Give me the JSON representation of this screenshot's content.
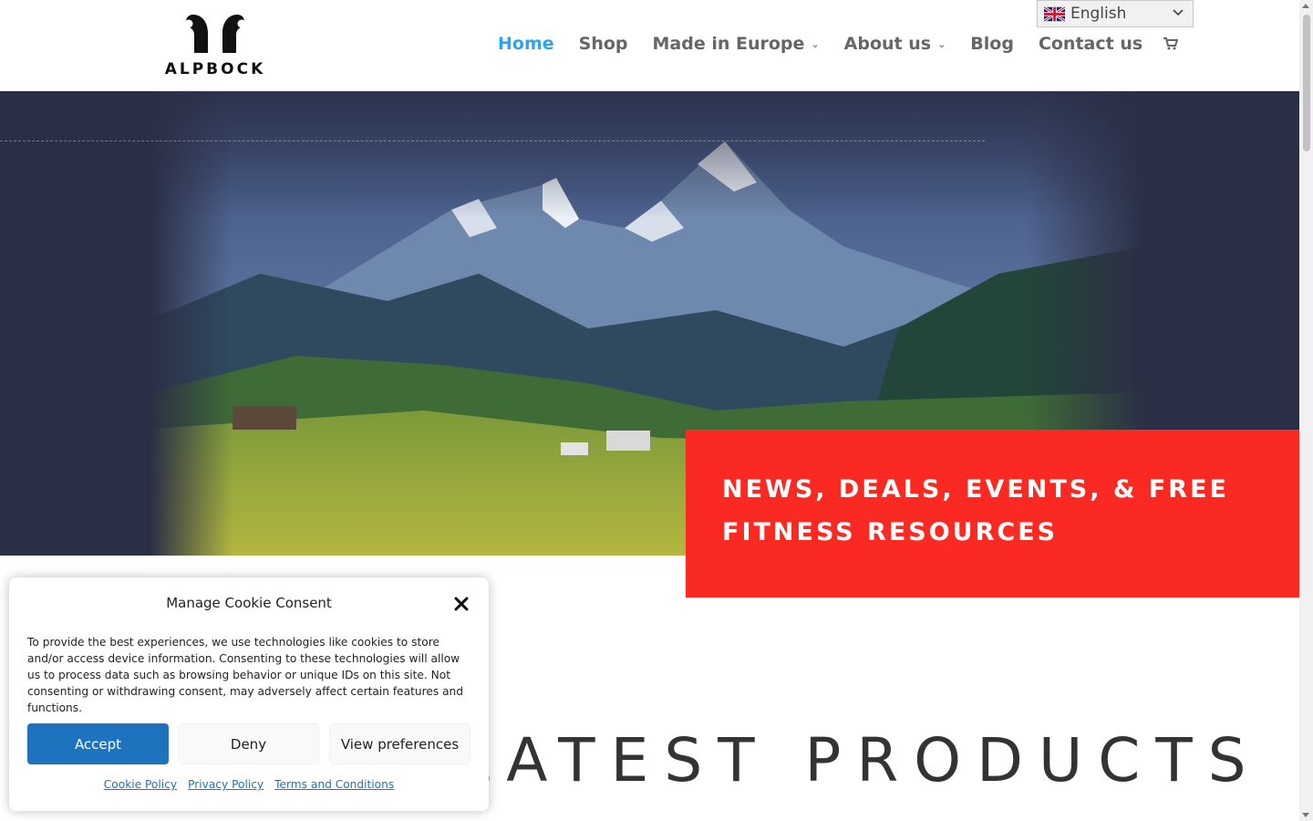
{
  "brand": {
    "name": "ALPBOCK"
  },
  "nav": {
    "items": [
      {
        "label": "Home",
        "active": true,
        "dropdown": false
      },
      {
        "label": "Shop",
        "active": false,
        "dropdown": false
      },
      {
        "label": "Made in Europe",
        "active": false,
        "dropdown": true
      },
      {
        "label": "About us",
        "active": false,
        "dropdown": true
      },
      {
        "label": "Blog",
        "active": false,
        "dropdown": false
      },
      {
        "label": "Contact us",
        "active": false,
        "dropdown": false
      }
    ],
    "cart_icon": "shopping-cart-icon"
  },
  "language": {
    "selected": "English",
    "flag_icon": "uk-flag-icon"
  },
  "hero": {
    "cta_text": "NEWS, DEALS, EVENTS, & FREE FITNESS RESOURCES"
  },
  "section": {
    "title": "LATEST PRODUCTS"
  },
  "cookie": {
    "title": "Manage Cookie Consent",
    "body": "To provide the best experiences, we use technologies like cookies to store and/or access device information. Consenting to these technologies will allow us to process data such as browsing behavior or unique IDs on this site. Not consenting or withdrawing consent, may adversely affect certain features and functions.",
    "accept_label": "Accept",
    "deny_label": "Deny",
    "prefs_label": "View preferences",
    "links": [
      "Cookie Policy",
      "Privacy Policy",
      "Terms and Conditions"
    ]
  },
  "colors": {
    "accent": "#2ea3f2",
    "cta_red": "#fa2922",
    "hero_bg": "#2b2f45",
    "accept_blue": "#1e73be"
  }
}
